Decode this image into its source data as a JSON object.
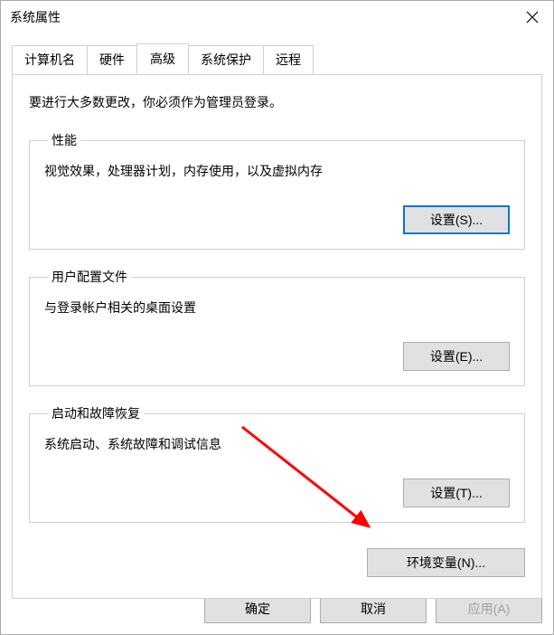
{
  "window": {
    "title": "系统属性"
  },
  "tabs": {
    "items": [
      {
        "label": "计算机名"
      },
      {
        "label": "硬件"
      },
      {
        "label": "高级"
      },
      {
        "label": "系统保护"
      },
      {
        "label": "远程"
      }
    ]
  },
  "panel": {
    "intro": "要进行大多数更改，你必须作为管理员登录。",
    "performance": {
      "legend": "性能",
      "desc": "视觉效果，处理器计划，内存使用，以及虚拟内存",
      "button": "设置(S)..."
    },
    "profiles": {
      "legend": "用户配置文件",
      "desc": "与登录帐户相关的桌面设置",
      "button": "设置(E)..."
    },
    "startup": {
      "legend": "启动和故障恢复",
      "desc": "系统启动、系统故障和调试信息",
      "button": "设置(T)..."
    },
    "env_button": "环境变量(N)..."
  },
  "footer": {
    "ok": "确定",
    "cancel": "取消",
    "apply": "应用(A)"
  }
}
